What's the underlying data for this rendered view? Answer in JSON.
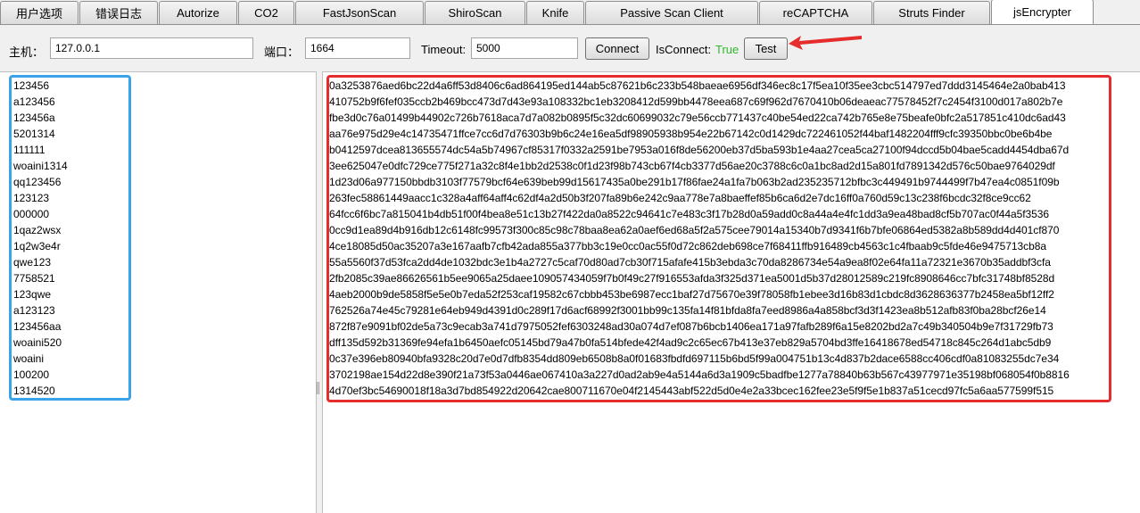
{
  "tabs": [
    {
      "label": "用户选项"
    },
    {
      "label": "错误日志"
    },
    {
      "label": "Autorize"
    },
    {
      "label": "CO2"
    },
    {
      "label": "FastJsonScan"
    },
    {
      "label": "ShiroScan"
    },
    {
      "label": "Knife"
    },
    {
      "label": "Passive Scan Client"
    },
    {
      "label": "reCAPTCHA"
    },
    {
      "label": "Struts Finder"
    },
    {
      "label": "jsEncrypter"
    }
  ],
  "toolbar": {
    "host_label": "主机：",
    "host_value": "127.0.0.1",
    "port_label": "端口：",
    "port_value": "1664",
    "timeout_label": "Timeout:",
    "timeout_value": "5000",
    "connect_label": "Connect",
    "isconnect_label": "IsConnect:",
    "isconnect_value": "True",
    "test_label": "Test"
  },
  "colors": {
    "status_true": "#2eb82e",
    "annotation_red": "#e52d2d",
    "annotation_blue": "#3ba3e8"
  },
  "passwords": [
    "123456",
    "a123456",
    "123456a",
    "5201314",
    "111111",
    "woaini1314",
    "qq123456",
    "123123",
    "000000",
    "1qaz2wsx",
    "1q2w3e4r",
    "qwe123",
    "7758521",
    "123qwe",
    "a123123",
    "123456aa",
    "woaini520",
    "woaini",
    "100200",
    "1314520"
  ],
  "encrypted": [
    "0a3253876aed6bc22d4a6ff53d8406c6ad864195ed144ab5c87621b6c233b548baeae6956df346ec8c17f5ea10f35ee3cbc514797ed7ddd3145464e2a0bab413",
    "410752b9f6fef035ccb2b469bcc473d7d43e93a108332bc1eb3208412d599bb4478eea687c69f962d7670410b06deaeac77578452f7c2454f3100d017a802b7e",
    "fbe3d0c76a01499b44902c726b7618aca7d7a082b0895f5c32dc60699032c79e56ccb771437c40be54ed22ca742b765e8e75beafe0bfc2a517851c410dc6ad43",
    "aa76e975d29e4c14735471ffce7cc6d7d76303b9b6c24e16ea5df98905938b954e22b67142c0d1429dc722461052f44baf1482204fff9cfc39350bbc0be6b4be",
    "b0412597dcea813655574dc54a5b74967cf85317f0332a2591be7953a016f8de56200eb37d5ba593b1e4aa27cea5ca27100f94dccd5b04bae5cadd4454dba67d",
    "3ee625047e0dfc729ce775f271a32c8f4e1bb2d2538c0f1d23f98b743cb67f4cb3377d56ae20c3788c6c0a1bc8ad2d15a801fd7891342d576c50bae9764029df",
    "1d23d06a977150bbdb3103f77579bcf64e639beb99d15617435a0be291b17f86fae24a1fa7b063b2ad235235712bfbc3c449491b9744499f7b47ea4c0851f09b",
    "263fec58861449aacc1c328a4aff64aff4c62df4a2d50b3f207fa89b6e242c9aa778e7a8baeffef85b6ca6d2e7dc16ff0a760d59c13c238f6bcdc32f8ce9cc62",
    "64fcc6f6bc7a815041b4db51f00f4bea8e51c13b27f422da0a8522c94641c7e483c3f17b28d0a59add0c8a44a4e4fc1dd3a9ea48bad8cf5b707ac0f44a5f3536",
    "0cc9d1ea89d4b916db12c6148fc99573f300c85c98c78baa8ea62a0aef6ed68a5f2a575cee79014a15340b7d9341f6b7bfe06864ed5382a8b589dd4d401cf870",
    "4ce18085d50ac35207a3e167aafb7cfb42ada855a377bb3c19e0cc0ac55f0d72c862deb698ce7f68411ffb916489cb4563c1c4fbaab9c5fde46e9475713cb8a",
    "55a5560f37d53fca2dd4de1032bdc3e1b4a2727c5caf70d80ad7cb30f715afafe415b3ebda3c70da8286734e54a9ea8f02e64fa11a72321e3670b35addbf3cfa",
    "2fb2085c39ae86626561b5ee9065a25daee109057434059f7b0f49c27f916553afda3f325d371ea5001d5b37d28012589c219fc8908646cc7bfc31748bf8528d",
    "4aeb2000b9de5858f5e5e0b7eda52f253caf19582c67cbbb453be6987ecc1baf27d75670e39f78058fb1ebee3d16b83d1cbdc8d3628636377b2458ea5bf12ff2",
    "762526a74e45c79281e64eb949d4391d0c289f17d6acf68992f3001bb99c135fa14f81bfda8fa7eed8986a4a858bcf3d3f1423ea8b512afb83f0ba28bcf26e14",
    "872f87e9091bf02de5a73c9ecab3a741d7975052fef6303248ad30a074d7ef087b6bcb1406ea171a97fafb289f6a15e8202bd2a7c49b340504b9e7f31729fb73",
    "dff135d592b31369fe94efa1b6450aefc05145bd79a47b0fa514bfede42f4ad9c2c65ec67b413e37eb829a5704bd3ffe16418678ed54718c845c264d1abc5db9",
    "0c37e396eb80940bfa9328c20d7e0d7dfb8354dd809eb6508b8a0f01683fbdfd697115b6bd5f99a004751b13c4d837b2dace6588cc406cdf0a81083255dc7e34",
    "3702198ae154d22d8e390f21a73f53a0446ae067410a3a227d0ad2ab9e4a5144a6d3a1909c5badfbe1277a78840b63b567c43977971e35198bf068054f0b8816",
    "4d70ef3bc54690018f18a3d7bd854922d20642cae800711670e04f2145443abf522d5d0e4e2a33bcec162fee23e5f9f5e1b837a51cecd97fc5a6aa577599f515"
  ]
}
